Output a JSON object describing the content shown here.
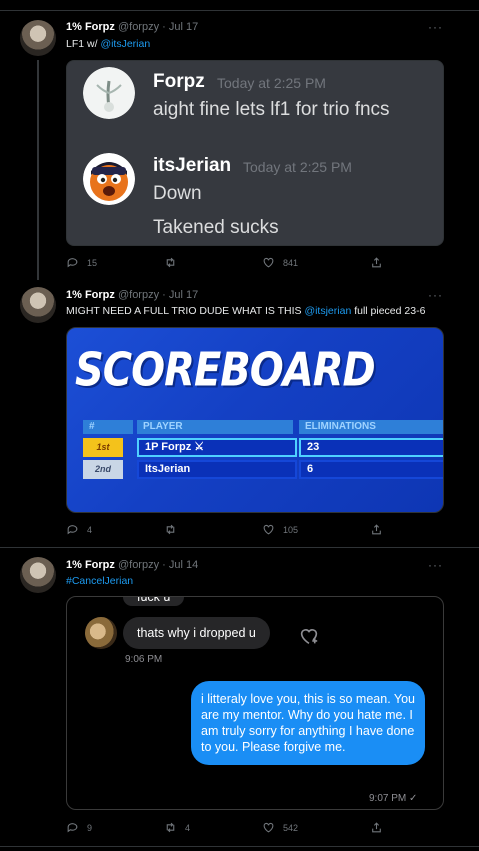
{
  "tweets": [
    {
      "name": "1% Forpz",
      "handle": "@forpzy",
      "sep": "·",
      "date": "Jul 17",
      "text_prefix": "LF1 w/ ",
      "text_link": "@itsJerian",
      "replies": "15",
      "retweets": "",
      "likes": "841",
      "discord": {
        "messages": [
          {
            "author": "Forpz",
            "time": "Today at 2:25 PM",
            "lines": [
              "aight fine lets lf1 for trio fncs"
            ]
          },
          {
            "author": "itsJerian",
            "time": "Today at 2:25 PM",
            "lines": [
              "Down",
              "Takened sucks"
            ]
          }
        ]
      }
    },
    {
      "name": "1% Forpz",
      "handle": "@forpzy",
      "sep": "·",
      "date": "Jul 17",
      "text_prefix": "MIGHT NEED A FULL TRIO DUDE WHAT IS THIS ",
      "text_link": "@itsjerian",
      "text_suffix": " full pieced 23-6",
      "replies": "4",
      "retweets": "",
      "likes": "105",
      "scoreboard": {
        "title": "SCOREBOARD",
        "col_rank": "#",
        "col_player": "PLAYER",
        "col_elims": "ELIMINATIONS",
        "rows": [
          {
            "rank": "1st",
            "player": "1P Forpz ⚔",
            "elims": "23"
          },
          {
            "rank": "2nd",
            "player": "ItsJerian",
            "elims": "6"
          }
        ]
      }
    },
    {
      "name": "1% Forpz",
      "handle": "@forpzy",
      "sep": "·",
      "date": "Jul 14",
      "text_link": "#CancelJerian",
      "replies": "9",
      "retweets": "4",
      "likes": "542",
      "imessage": {
        "cut_text": "fuck u",
        "received": "thats why i dropped u",
        "received_time": "9:06 PM",
        "sent": "i litteraly love you, this is so mean. You are my mentor. Why do you hate me. I am truly sorry for anything I have done to you. Please forgive me.",
        "sent_time": "9:07 PM ✓"
      }
    }
  ],
  "icons": {
    "more": "more-dots-icon",
    "reply": "reply-icon",
    "retweet": "retweet-icon",
    "like": "heart-icon",
    "share": "share-icon"
  },
  "colors": {
    "background": "#000000",
    "link": "#1d9bf0",
    "discord_bg": "#36393f",
    "imessage_blue": "#1a8ef5",
    "scoreboard_blue": "#1440c4"
  },
  "more_label": "···"
}
